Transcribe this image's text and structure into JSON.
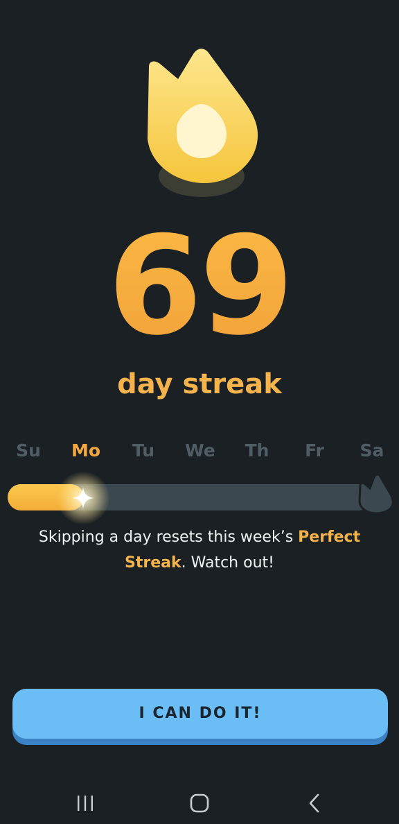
{
  "streak": {
    "count": "69",
    "label": "day streak"
  },
  "week": {
    "days": [
      "Su",
      "Mo",
      "Tu",
      "We",
      "Th",
      "Fr",
      "Sa"
    ],
    "active_day": "Mo",
    "progress_fraction": 0.21
  },
  "message": {
    "part1": "Skipping a day resets this week’s ",
    "highlight": "Perfect Streak",
    "part2": ". Watch out!"
  },
  "cta": {
    "label": "I CAN DO IT!"
  },
  "icons": {
    "hero": "flame-icon",
    "progress_marker": "sparkle-icon",
    "week_goal": "flame-icon",
    "nav_recents": "recents-icon",
    "nav_home": "home-icon",
    "nav_back": "back-icon"
  },
  "colors": {
    "background": "#1a2024",
    "accent": "#f5b34c",
    "inactive_day": "#515d65",
    "track": "#3b4850",
    "button": "#6bbdf5",
    "button_shadow": "#3b83c4"
  }
}
